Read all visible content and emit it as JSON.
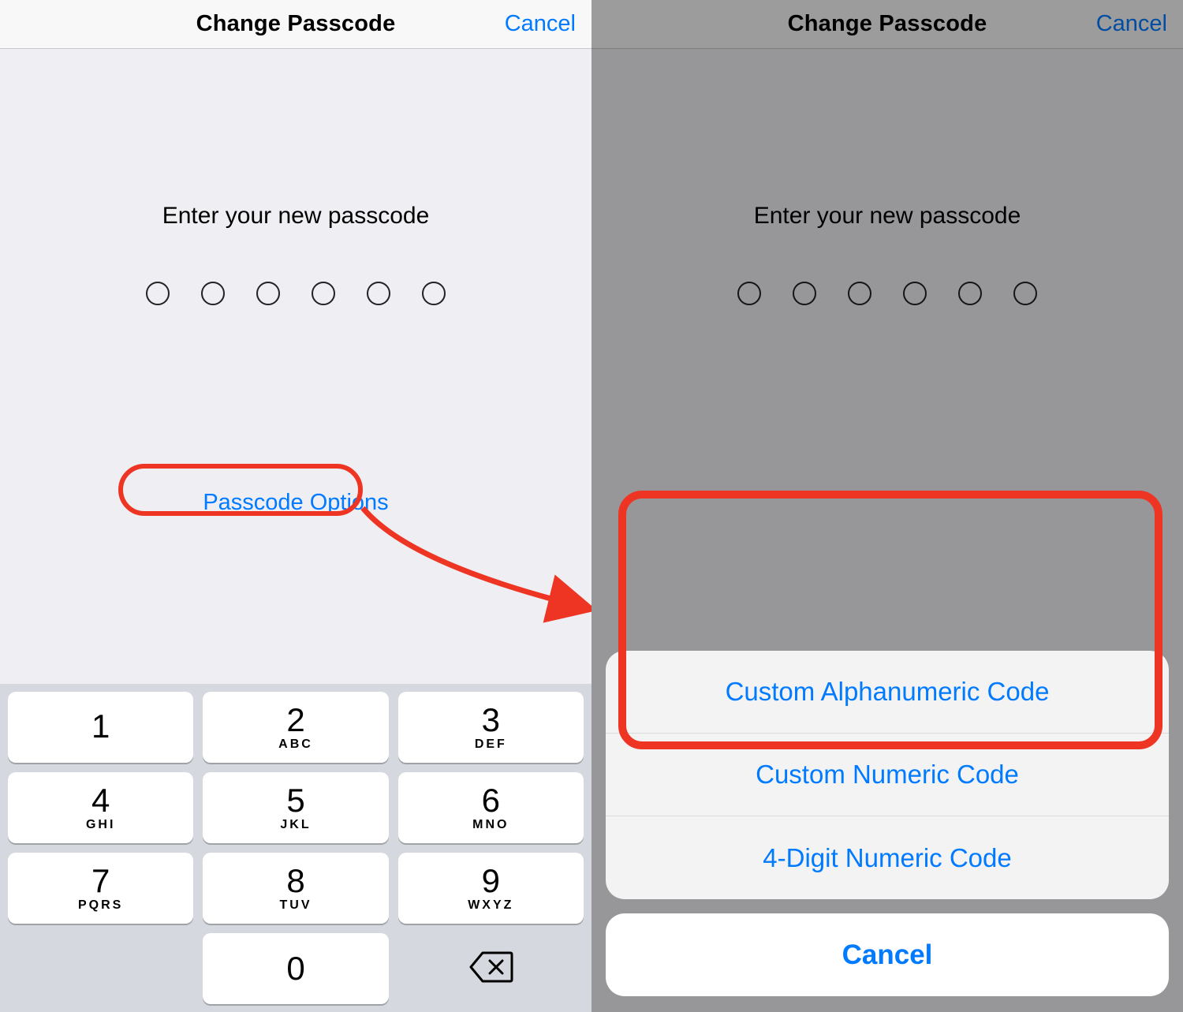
{
  "left": {
    "nav": {
      "title": "Change Passcode",
      "cancel": "Cancel"
    },
    "prompt": "Enter your new passcode",
    "passcode_length": 6,
    "options_link": "Passcode Options",
    "keypad": [
      {
        "digit": "1",
        "letters": ""
      },
      {
        "digit": "2",
        "letters": "ABC"
      },
      {
        "digit": "3",
        "letters": "DEF"
      },
      {
        "digit": "4",
        "letters": "GHI"
      },
      {
        "digit": "5",
        "letters": "JKL"
      },
      {
        "digit": "6",
        "letters": "MNO"
      },
      {
        "digit": "7",
        "letters": "PQRS"
      },
      {
        "digit": "8",
        "letters": "TUV"
      },
      {
        "digit": "9",
        "letters": "WXYZ"
      },
      {
        "digit": "0",
        "letters": ""
      }
    ],
    "backspace_icon": "backspace-icon"
  },
  "right": {
    "nav": {
      "title": "Change Passcode",
      "cancel": "Cancel"
    },
    "prompt": "Enter your new passcode",
    "passcode_length": 6,
    "sheet": {
      "options": [
        "Custom Alphanumeric Code",
        "Custom Numeric Code",
        "4-Digit Numeric Code"
      ],
      "cancel": "Cancel"
    }
  },
  "annotation": {
    "color": "#ee3524"
  }
}
